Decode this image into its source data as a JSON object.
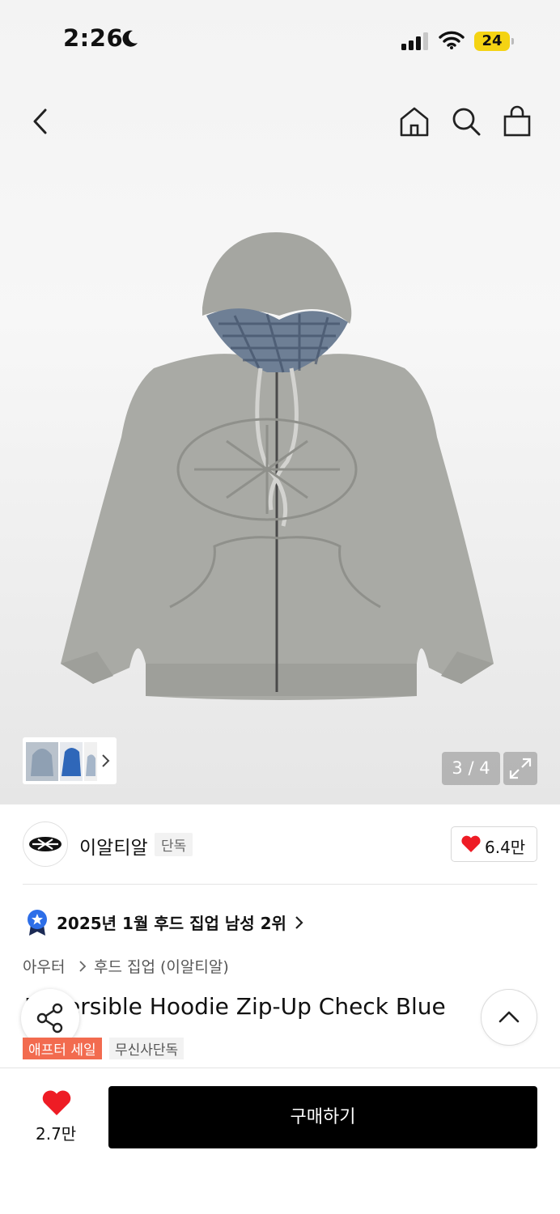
{
  "status_bar": {
    "time": "2:26",
    "battery": "24"
  },
  "product": {
    "image_counter": "3 / 4",
    "brand": {
      "name": "이알티알",
      "badge": "단독",
      "likes": "6.4만"
    },
    "ranking": "2025년 1월 후드 집업 남성 2위",
    "breadcrumb": [
      "아우터",
      "후드 집업 (이알티알)"
    ],
    "title": "Reversible Hoodie Zip-Up Check Blue",
    "tags": [
      "애프터 세일",
      "무신사단독"
    ]
  },
  "bottom_bar": {
    "favorites": "2.7만",
    "buy_label": "구매하기"
  },
  "colors": {
    "accent_red": "#ee1c25",
    "sale_tag": "#f26b4f",
    "button_black": "#000000",
    "rank_blue": "#2d6ee8"
  },
  "icons": [
    "back-icon",
    "home-icon",
    "search-icon",
    "shopping-bag-icon",
    "expand-icon",
    "heart-icon",
    "share-icon",
    "chevron-up-icon",
    "ranking-badge-icon"
  ]
}
